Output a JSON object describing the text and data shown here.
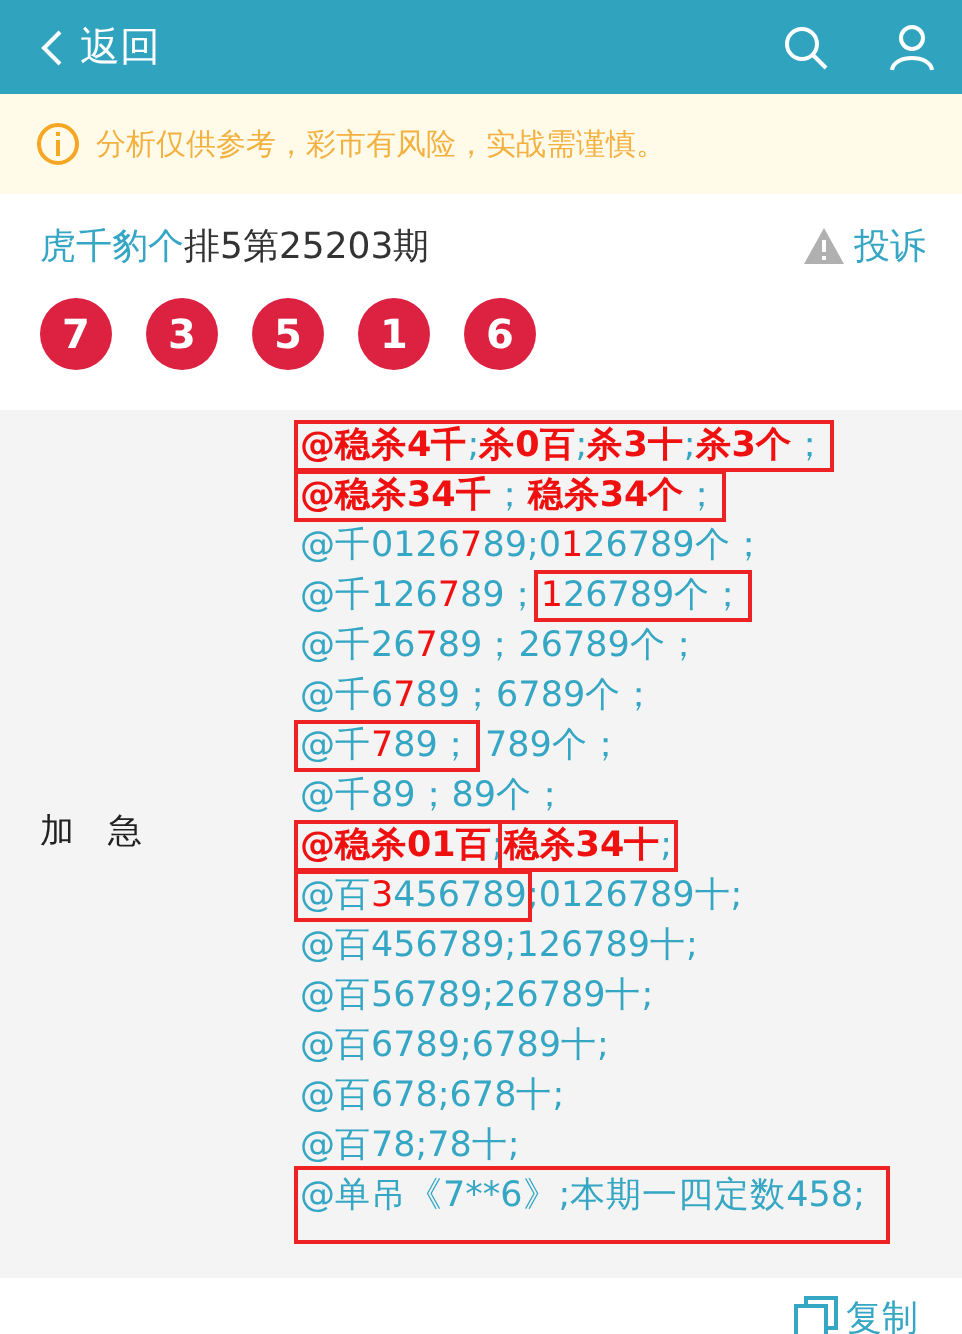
{
  "header": {
    "back_label": "返回"
  },
  "notice": {
    "text": "分析仅供参考，彩市有风险，实战需谨慎。"
  },
  "title": {
    "author": "虎千豹个",
    "issue": "排5第25203期",
    "report_label": "投诉"
  },
  "balls": [
    "7",
    "3",
    "5",
    "1",
    "6"
  ],
  "post": {
    "label": "加　急",
    "lines": [
      [
        {
          "framed": true,
          "spans": [
            {
              "text": "@稳杀4千",
              "kind": "red-bold"
            },
            {
              "text": ";",
              "kind": "plain"
            },
            {
              "text": "杀0百",
              "kind": "red-bold"
            },
            {
              "text": ";",
              "kind": "plain"
            },
            {
              "text": "杀3十",
              "kind": "red-bold"
            },
            {
              "text": ";",
              "kind": "plain"
            },
            {
              "text": "杀3个",
              "kind": "red-bold"
            },
            {
              "text": "；",
              "kind": "plain"
            }
          ]
        }
      ],
      [
        {
          "framed": true,
          "spans": [
            {
              "text": "@稳杀34千",
              "kind": "red-bold"
            },
            {
              "text": "；",
              "kind": "plain"
            },
            {
              "text": "稳杀34个",
              "kind": "red-bold"
            },
            {
              "text": "；",
              "kind": "plain"
            }
          ]
        }
      ],
      [
        {
          "text": "@千0126",
          "kind": "plain"
        },
        {
          "text": "7",
          "kind": "red"
        },
        {
          "text": "89;0",
          "kind": "plain"
        },
        {
          "text": "1",
          "kind": "red"
        },
        {
          "text": "26789个；",
          "kind": "plain"
        }
      ],
      [
        {
          "text": "@千126",
          "kind": "plain"
        },
        {
          "text": "7",
          "kind": "red"
        },
        {
          "text": "89；",
          "kind": "plain"
        },
        {
          "framed": true,
          "spans": [
            {
              "text": "1",
              "kind": "red"
            },
            {
              "text": "26789个；",
              "kind": "plain"
            }
          ]
        }
      ],
      [
        {
          "text": "@千26",
          "kind": "plain"
        },
        {
          "text": "7",
          "kind": "red"
        },
        {
          "text": "89；26789个；",
          "kind": "plain"
        }
      ],
      [
        {
          "text": "@千6",
          "kind": "plain"
        },
        {
          "text": "7",
          "kind": "red"
        },
        {
          "text": "89；6789个；",
          "kind": "plain"
        }
      ],
      [
        {
          "framed": true,
          "spans": [
            {
              "text": "@千",
              "kind": "plain"
            },
            {
              "text": "7",
              "kind": "red"
            },
            {
              "text": "89；",
              "kind": "plain"
            }
          ]
        },
        {
          "text": " 789个；",
          "kind": "plain"
        }
      ],
      [
        {
          "text": "@千89；89个；",
          "kind": "plain"
        }
      ],
      [
        {
          "framed": true,
          "spans": [
            {
              "text": "@稳杀01百",
              "kind": "red-bold"
            },
            {
              "text": ";",
              "kind": "plain"
            },
            {
              "framed": true,
              "spans": [
                {
                  "text": "稳杀34十",
                  "kind": "red-bold"
                },
                {
                  "text": ";",
                  "kind": "plain"
                }
              ]
            }
          ]
        }
      ],
      [
        {
          "framed": true,
          "spans": [
            {
              "text": "@百",
              "kind": "plain"
            },
            {
              "text": "3",
              "kind": "red"
            },
            {
              "text": "456789",
              "kind": "plain"
            }
          ]
        },
        {
          "text": ";0126789十;",
          "kind": "plain"
        }
      ],
      [
        {
          "text": "@百456789;126789十;",
          "kind": "plain"
        }
      ],
      [
        {
          "text": "@百56789;26789十;",
          "kind": "plain"
        }
      ],
      [
        {
          "text": "@百6789;6789十;",
          "kind": "plain"
        }
      ],
      [
        {
          "text": "@百678;678十;",
          "kind": "plain"
        }
      ],
      [
        {
          "text": "@百78;78十;",
          "kind": "plain"
        }
      ],
      [
        {
          "framed": true,
          "spans": [
            {
              "text": "@单吊《7**6》;本期一四定数458;",
              "kind": "plain"
            }
          ]
        }
      ]
    ]
  },
  "copy_label": "复制"
}
